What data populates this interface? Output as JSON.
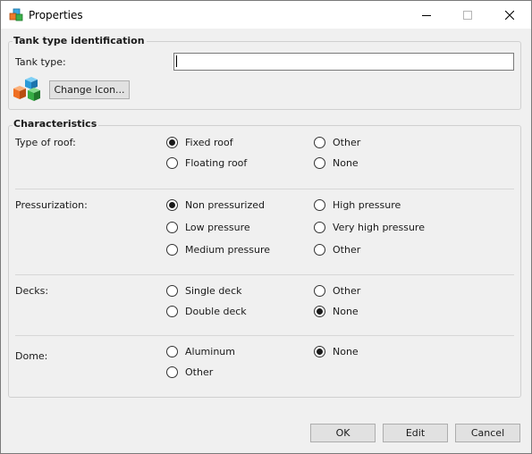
{
  "window": {
    "title": "Properties",
    "icon": "tank-cubes-icon"
  },
  "identification": {
    "group_title": "Tank type identification",
    "tank_type_label": "Tank type:",
    "tank_type_value": "",
    "change_icon_label": "Change Icon..."
  },
  "characteristics": {
    "group_title": "Characteristics",
    "roof": {
      "label": "Type of roof:",
      "options": [
        {
          "label": "Fixed roof",
          "checked": true
        },
        {
          "label": "Other",
          "checked": false
        },
        {
          "label": "Floating roof",
          "checked": false
        },
        {
          "label": "None",
          "checked": false
        }
      ]
    },
    "pressurization": {
      "label": "Pressurization:",
      "options": [
        {
          "label": "Non pressurized",
          "checked": true
        },
        {
          "label": "High pressure",
          "checked": false
        },
        {
          "label": "Low pressure",
          "checked": false
        },
        {
          "label": "Very high pressure",
          "checked": false
        },
        {
          "label": "Medium pressure",
          "checked": false
        },
        {
          "label": "Other",
          "checked": false
        }
      ]
    },
    "decks": {
      "label": "Decks:",
      "options": [
        {
          "label": "Single deck",
          "checked": false
        },
        {
          "label": "Other",
          "checked": false
        },
        {
          "label": "Double deck",
          "checked": false
        },
        {
          "label": "None",
          "checked": true
        }
      ]
    },
    "dome": {
      "label": "Dome:",
      "options": [
        {
          "label": "Aluminum",
          "checked": false
        },
        {
          "label": "None",
          "checked": true
        },
        {
          "label": "Other",
          "checked": false
        }
      ]
    }
  },
  "buttons": {
    "ok": "OK",
    "edit": "Edit",
    "cancel": "Cancel"
  }
}
